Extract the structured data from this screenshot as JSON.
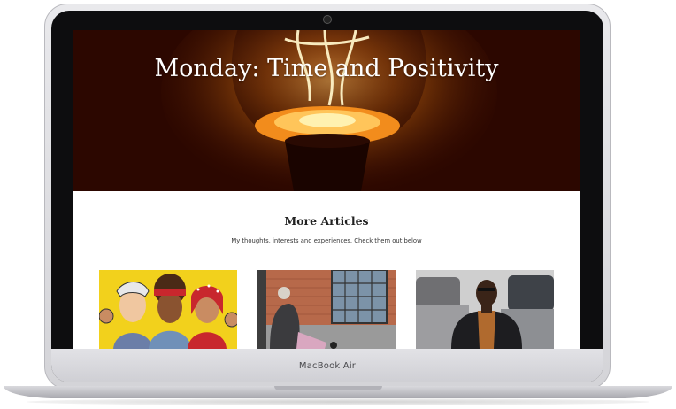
{
  "device": {
    "label": "MacBook Air"
  },
  "hero": {
    "title": "Monday: Time and Positivity"
  },
  "articles_section": {
    "title": "More Articles",
    "subtitle": "My thoughts, interests and experiences. Check them out below"
  },
  "article_cards": [
    {
      "image_icon": "illustrated-women-image"
    },
    {
      "image_icon": "street-photo-image"
    },
    {
      "image_icon": "portrait-photo-image"
    }
  ],
  "colors": {
    "hero_bg": "#3a0e02",
    "glow": "#ffb347",
    "card1_bg": "#f2d11c"
  }
}
